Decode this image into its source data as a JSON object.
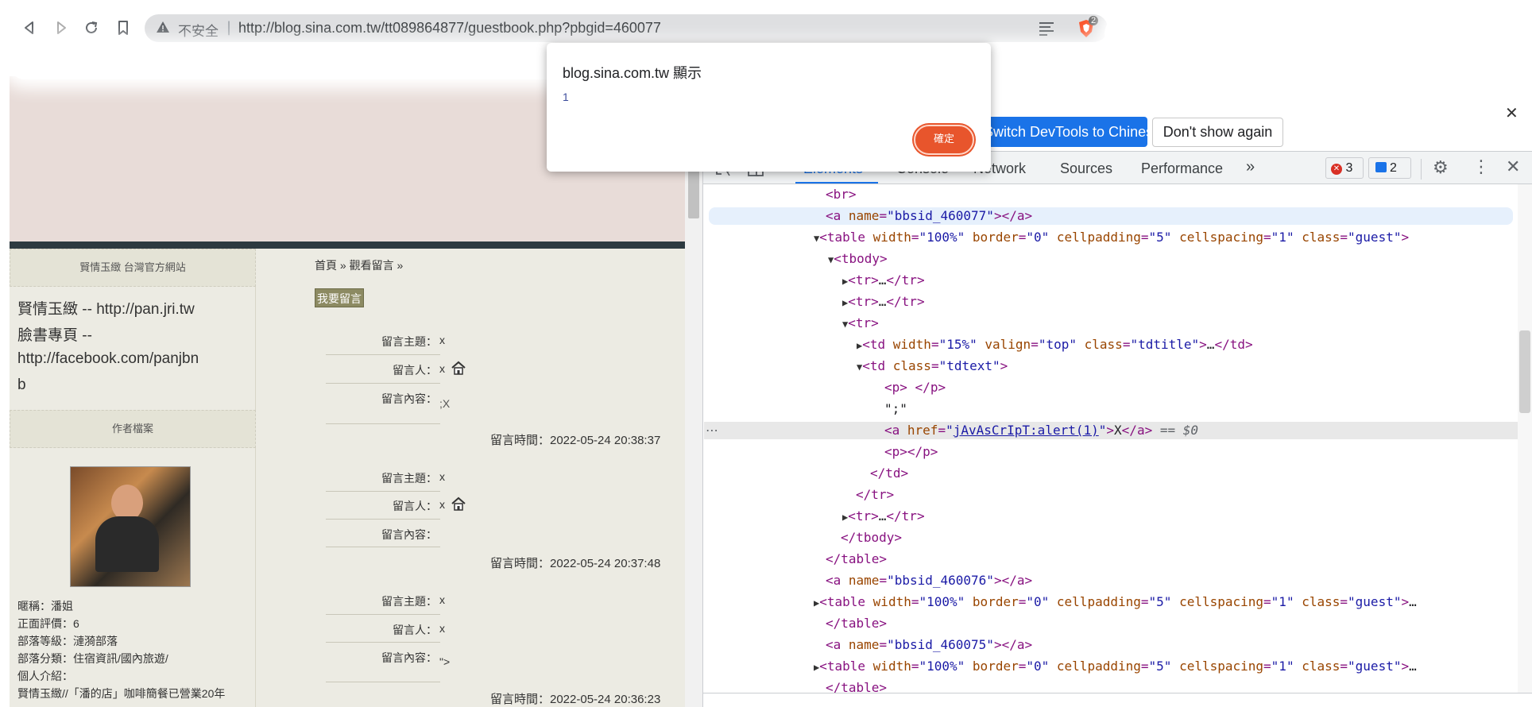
{
  "browser": {
    "nav": {
      "back_icon": "back-arrow-icon",
      "forward_icon": "forward-arrow-icon",
      "reload_icon": "reload-icon",
      "bookmark_icon": "bookmark-icon"
    },
    "security_label": "不安全",
    "url": "http://blog.sina.com.tw/tt089864877/guestbook.php?pbgid=460077",
    "brave_count": "2"
  },
  "page": {
    "sidebar": {
      "site_title": "賢情玉緻 台灣官方網站",
      "links_text_1": "賢情玉緻 -- http://pan.jri.tw",
      "links_text_2": "臉書專頁 --",
      "links_text_3": "http://facebook.com/panjbn",
      "links_text_4": "b",
      "profile_header": "作者檔案",
      "profile": [
        "暱稱：潘姐",
        "正面評價：6",
        "部落等級：漣漪部落",
        "部落分類：住宿資訊/國內旅遊/",
        "個人介紹：",
        "賢情玉緻//「潘的店」咖啡簡餐已營業20年"
      ]
    },
    "breadcrumb": "首頁 » 觀看留言 »",
    "post_button": "我要留言",
    "entries": [
      {
        "subject_label": "留言主題：",
        "subject": "x",
        "author_label": "留言人：",
        "author": "x",
        "content_label": "留言內容：",
        "content": ";X",
        "time": "留言時間：2022-05-24 20:38:37"
      },
      {
        "subject_label": "留言主題：",
        "subject": "x",
        "author_label": "留言人：",
        "author": "x",
        "content_label": "留言內容：",
        "content": "",
        "time": "留言時間：2022-05-24 20:37:48"
      },
      {
        "subject_label": "留言主題：",
        "subject": "x",
        "author_label": "留言人：",
        "author": "x",
        "content_label": "留言內容：",
        "content": "\">",
        "time": "留言時間：2022-05-24 20:36:23"
      }
    ]
  },
  "dialog": {
    "title": "blog.sina.com.tw 顯示",
    "message": "1",
    "ok_label": "確定"
  },
  "devtools": {
    "infobar": {
      "switch_label": "Switch DevTools to Chinese",
      "dont_show_label": "Don't show again"
    },
    "tabs": [
      "Elements",
      "Console",
      "Network",
      "Sources",
      "Performance"
    ],
    "more_tabs": "»",
    "errors": "3",
    "messages": "2",
    "selected_suffix": "== $0",
    "colors": {
      "accent": "#1a73e8",
      "tag": "#881280",
      "attr_name": "#994500",
      "attr_value": "#1a1aa6"
    }
  }
}
